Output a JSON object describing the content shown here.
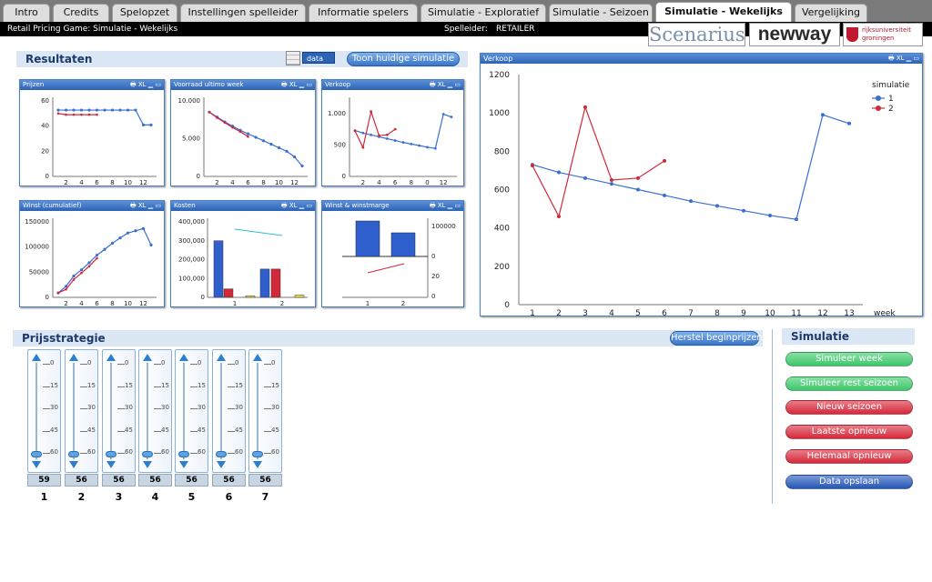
{
  "tabs": [
    "Intro",
    "Credits",
    "Spelopzet",
    "Instellingen spelleider",
    "Informatie spelers",
    "Simulatie - Exploratief",
    "Simulatie - Seizoen",
    "Simulatie - Wekelijks",
    "Vergelijking"
  ],
  "header": {
    "game_title": "Retail Pricing Game: Simulatie - Wekelijks",
    "spelleider_label": "Spelleider:",
    "spelleider_value": "RETAILER"
  },
  "logos": {
    "scenarius": "Scenarius",
    "newway": "newway",
    "rug": "rijksuniversiteit groningen"
  },
  "resultaten": {
    "title": "Resultaten",
    "data_label": "data",
    "show_button": "Toon huidige simulatie"
  },
  "caption_icons": "🖶 XL ▁ ▭",
  "charts": {
    "prijzen": {
      "title": "Prijzen",
      "yticks": [
        "60",
        "40",
        "20",
        "0"
      ],
      "xticks": [
        "2",
        "4",
        "6",
        "8",
        "10",
        "12"
      ],
      "s1": [
        58,
        58,
        58,
        58,
        58,
        58,
        58,
        58,
        58,
        58,
        58,
        45,
        45
      ],
      "s2": [
        55,
        54,
        54,
        54,
        54,
        54
      ]
    },
    "voorraad": {
      "title": "Voorraad ultimo week",
      "yticks": [
        "10.000",
        "5.000",
        "0"
      ],
      "xticks": [
        "2",
        "4",
        "6",
        "8",
        "10",
        "12"
      ],
      "s1": [
        9200,
        8500,
        7800,
        7200,
        6600,
        6100,
        5600,
        5100,
        4600,
        4100,
        3600,
        2800,
        1500
      ],
      "s2": [
        9200,
        8400,
        7700,
        7000,
        6400,
        5700
      ]
    },
    "verkoop_small": {
      "title": "Verkoop",
      "yticks": [
        "1.000",
        "500",
        "0"
      ],
      "xticks": [
        "2",
        "4",
        "6",
        "8",
        "0",
        "12"
      ]
    },
    "winst": {
      "title": "Winst (cumulatief)",
      "yticks": [
        "150000",
        "100000",
        "50000",
        "0"
      ],
      "xticks": [
        "2",
        "4",
        "6",
        "8",
        "10",
        "12"
      ],
      "s1": [
        10000,
        25000,
        48000,
        62000,
        78000,
        95000,
        108000,
        122000,
        134000,
        145000,
        150000,
        155000,
        118000
      ],
      "s2": [
        10000,
        18000,
        40000,
        55000,
        70000,
        88000
      ]
    },
    "kosten": {
      "title": "Kosten",
      "yticks": [
        "400,000",
        "300,000",
        "200,000",
        "100,000",
        "0"
      ],
      "xticks": [
        "1",
        "2"
      ]
    },
    "winstmarge": {
      "title": "Winst & winstmarge",
      "yticks_right": [
        "100000",
        "0",
        "20",
        "0"
      ],
      "xticks": [
        "1",
        "2"
      ]
    }
  },
  "verkoop": {
    "title": "Verkoop",
    "legend_title": "simulatie",
    "xlabel": "week",
    "chart_data": {
      "type": "line",
      "x": [
        1,
        2,
        3,
        4,
        5,
        6,
        7,
        8,
        9,
        10,
        11,
        12,
        13
      ],
      "ylim": [
        0,
        1200
      ],
      "yticks": [
        "1200",
        "1000",
        "800",
        "600",
        "400",
        "200",
        "0"
      ],
      "series": [
        {
          "name": "1",
          "color": "#3a6fd0",
          "values": [
            730,
            690,
            660,
            630,
            600,
            570,
            540,
            515,
            490,
            465,
            445,
            990,
            945
          ]
        },
        {
          "name": "2",
          "color": "#d02a3a",
          "values": [
            725,
            460,
            1030,
            650,
            660,
            750
          ]
        }
      ]
    }
  },
  "prijsstrategie": {
    "title": "Prijsstrategie",
    "reset_button": "Herstel beginprijzen",
    "ticks": [
      "0",
      "15",
      "30",
      "45",
      "60"
    ],
    "sliders": [
      {
        "value": "59",
        "week": "1"
      },
      {
        "value": "56",
        "week": "2"
      },
      {
        "value": "56",
        "week": "3"
      },
      {
        "value": "56",
        "week": "4"
      },
      {
        "value": "56",
        "week": "5"
      },
      {
        "value": "56",
        "week": "6"
      },
      {
        "value": "56",
        "week": "7"
      }
    ]
  },
  "simulatie": {
    "title": "Simulatie",
    "buttons": [
      {
        "label": "Simuleer week",
        "color": "#3cc86a"
      },
      {
        "label": "Simuleer rest seizoen",
        "color": "#3cc86a"
      },
      {
        "label": "Nieuw seizoen",
        "color": "#d7283a"
      },
      {
        "label": "Laatste opnieuw",
        "color": "#d7283a"
      },
      {
        "label": "Helemaal opnieuw",
        "color": "#d7283a"
      },
      {
        "label": "Data opslaan",
        "color": "#2457b8"
      }
    ]
  }
}
